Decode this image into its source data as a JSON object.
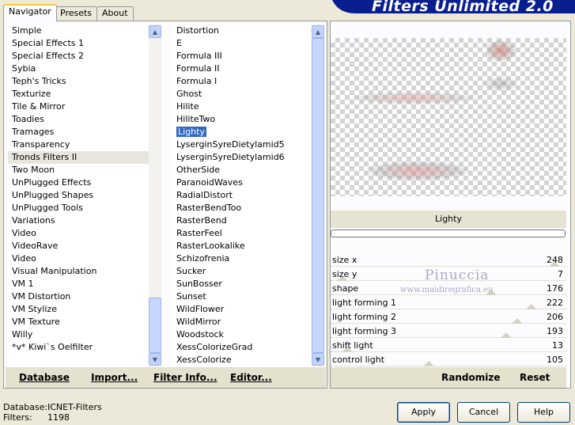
{
  "tabs": [
    {
      "label": "Navigator",
      "active": true
    },
    {
      "label": "Presets",
      "active": false
    },
    {
      "label": "About",
      "active": false
    }
  ],
  "banner_title": "Filters Unlimited 2.0",
  "categories": [
    "Simple",
    "Special Effects 1",
    "Special Effects 2",
    "Sybia",
    "Teph's Tricks",
    "Texturize",
    "Tile & Mirror",
    "Toadies",
    "Tramages",
    "Transparency",
    "Tronds Filters II",
    "Two Moon",
    "UnPlugged Effects",
    "UnPlugged Shapes",
    "UnPlugged Tools",
    "Variations",
    "Video",
    "VideoRave",
    "Video",
    "Visual Manipulation",
    "VM 1",
    "VM Distortion",
    "VM Stylize",
    "VM Texture",
    "Willy",
    "*v* Kiwi`s Oelfilter"
  ],
  "selected_category": "Tronds Filters II",
  "filters": [
    "Distortion",
    "E",
    "Formula III",
    "Formula II",
    "Formula I",
    "Ghost",
    "Hilite",
    "HiliteTwo",
    "Lighty",
    "LyserginSyreDietylamid5",
    "LyserginSyreDietylamid6",
    "OtherSide",
    "ParanoidWaves",
    "RadialDistort",
    "RasterBendToo",
    "RasterBend",
    "RasterFeel",
    "RasterLookalike",
    "Schizofrenia",
    "Sucker",
    "SunBosser",
    "Sunset",
    "WildFlower",
    "WildMirror",
    "Woodstock",
    "XessColorizeGrad",
    "XessColorize"
  ],
  "selected_filter": "Lighty",
  "bottom_buttons": {
    "database": "Database",
    "import": "Import...",
    "filter_info": "Filter Info...",
    "editor": "Editor..."
  },
  "preview_filter_name": "Lighty",
  "params": [
    {
      "label": "size x",
      "value": "248",
      "level": 0.973
    },
    {
      "label": "size y",
      "value": "7",
      "level": 0.027
    },
    {
      "label": "shape",
      "value": "176",
      "level": 0.69
    },
    {
      "label": "light forming 1",
      "value": "222",
      "level": 0.871
    },
    {
      "label": "light forming 2",
      "value": "206",
      "level": 0.808
    },
    {
      "label": "light forming 3",
      "value": "193",
      "level": 0.757
    },
    {
      "label": "shift light",
      "value": "13",
      "level": 0.051
    },
    {
      "label": "control light",
      "value": "105",
      "level": 0.412
    }
  ],
  "watermark": {
    "title": "Pinuccia",
    "url": "www.maidiregrafica.eu"
  },
  "right_buttons": {
    "randomize": "Randomize",
    "reset": "Reset"
  },
  "status": {
    "database_label": "Database:",
    "database_value": "ICNET-Filters",
    "filters_label": "Filters:",
    "filters_value": "1198"
  },
  "dialog_buttons": {
    "apply": "Apply",
    "cancel": "Cancel",
    "help": "Help"
  },
  "colors": {
    "selection": "#316ac5",
    "banner": "#0a1f8f",
    "tab_highlight": "#ffc83c"
  },
  "icons": {
    "scroll_up": "▲",
    "scroll_down": "▼"
  }
}
